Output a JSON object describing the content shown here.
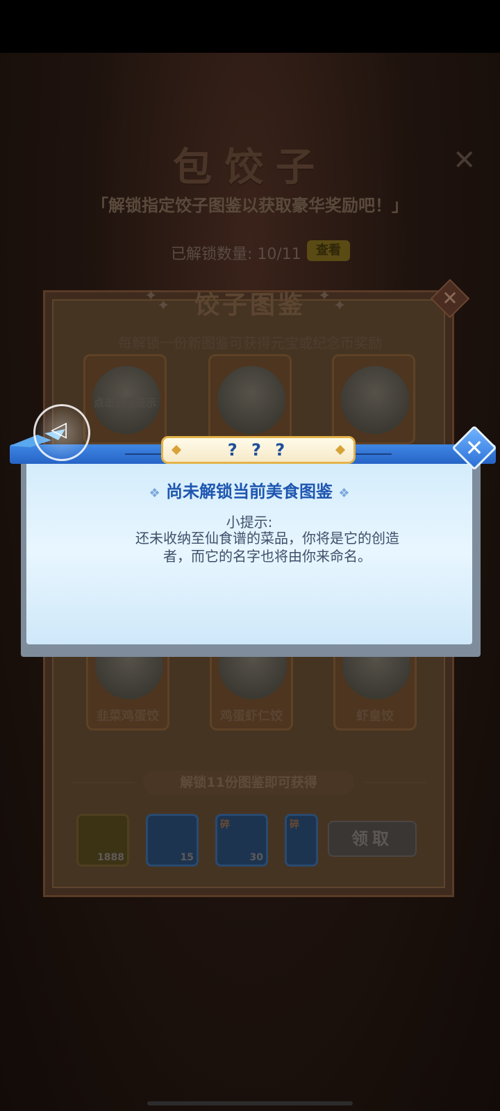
{
  "event": {
    "title": "包饺子",
    "subtitle": "「解锁指定饺子图鉴以获取豪华奖励吧！」",
    "unlock_count": "已解锁数量: 10/11",
    "view_label": "查看"
  },
  "book": {
    "title": "饺子图鉴",
    "description": "每解锁一份新图鉴可获得元宝或纪念币奖励",
    "top_cards": [
      {
        "hint": "点击查看提示"
      },
      {
        "hint": ""
      },
      {
        "hint": ""
      }
    ],
    "lower_cards": [
      {
        "name": "韭菜鸡蛋饺"
      },
      {
        "name": "鸡蛋虾仁饺"
      },
      {
        "name": "虾皇饺"
      }
    ],
    "reward_label": "解锁11份图鉴即可获得",
    "rewards": [
      {
        "count": "1888",
        "icon": "gold-ingot-icon"
      },
      {
        "count": "15",
        "icon": "sword-crest-icon"
      },
      {
        "count": "30",
        "icon": "fragment-icon",
        "tag": "碎"
      },
      {
        "count": "",
        "icon": "fragment-icon",
        "tag": "碎"
      }
    ],
    "claim_label": "领取"
  },
  "popup": {
    "title": "? ? ?",
    "heading": "尚未解锁当前美食图鉴",
    "hint_label": "小提示:",
    "hint_text": "还未收纳至仙食谱的菜品，你将是它的创造者，而它的名字也将由你来命名。",
    "close_glyph": "✕"
  },
  "colors": {
    "popup_accent": "#2664c6",
    "popup_body": "#e0f2fd",
    "heading_text": "#1e56b0",
    "plaque_border": "#e3b34a"
  }
}
